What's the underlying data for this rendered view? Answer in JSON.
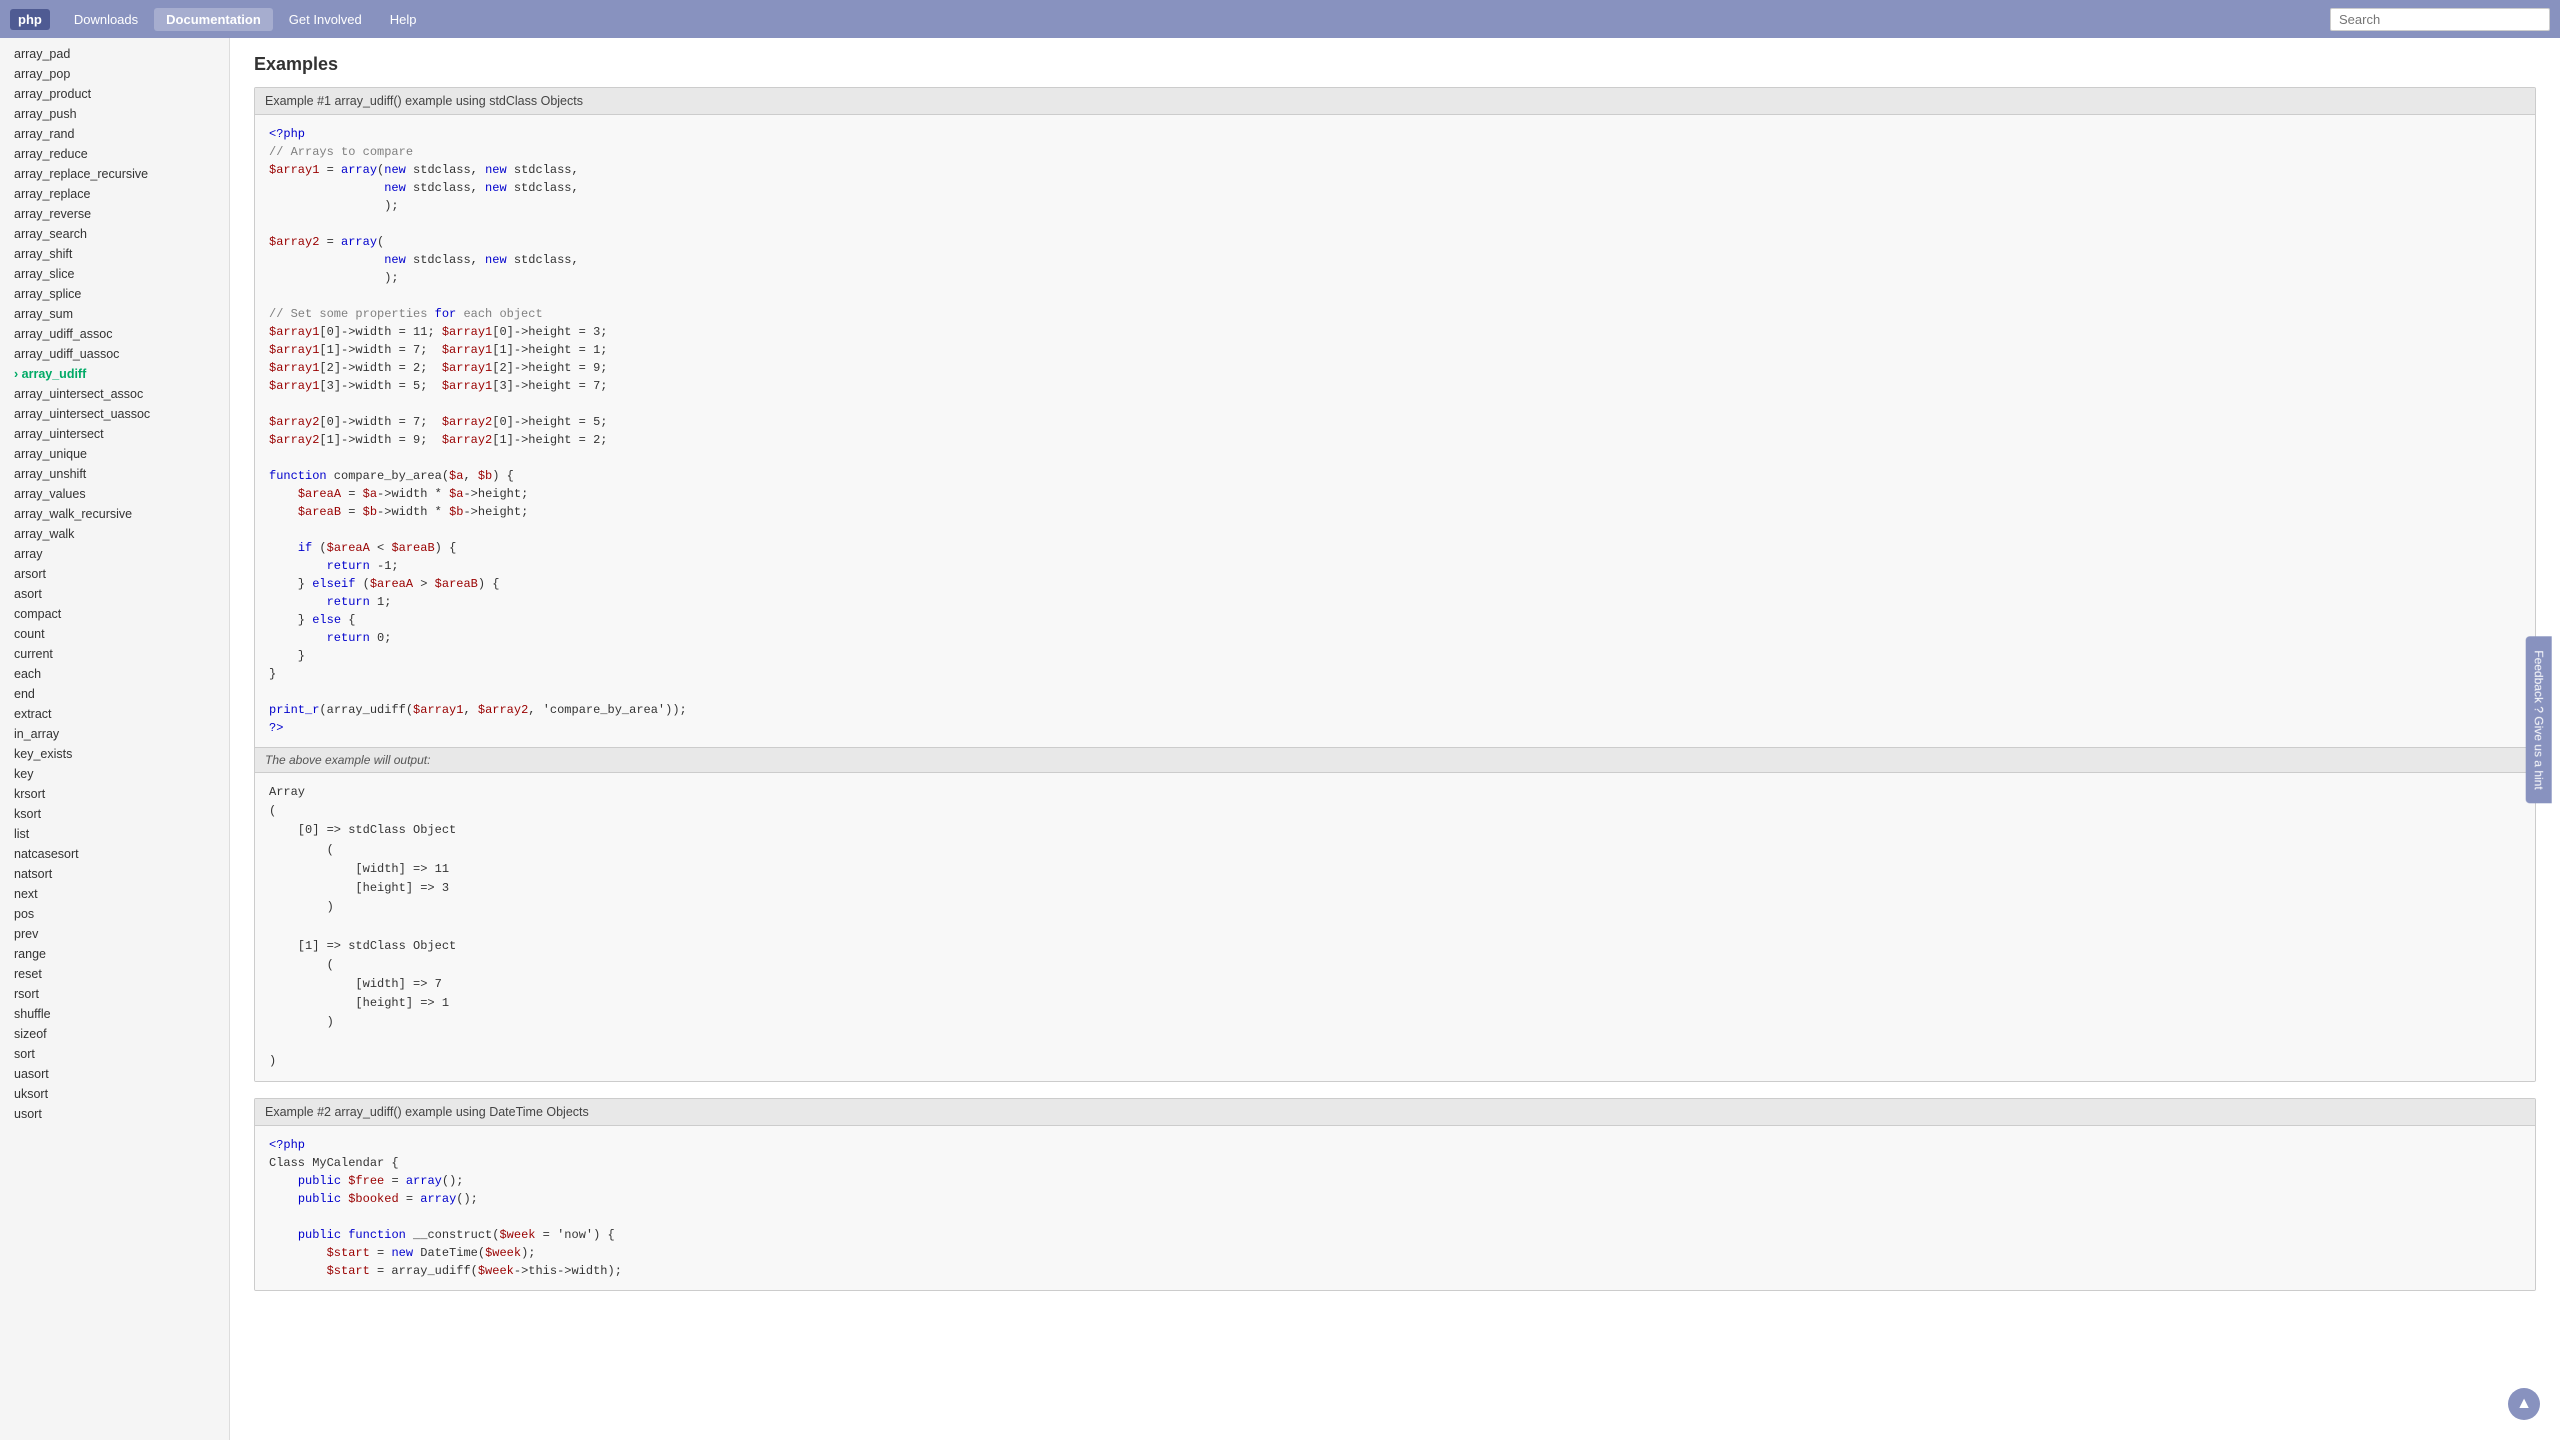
{
  "nav": {
    "logo": "php",
    "items": [
      {
        "label": "Downloads",
        "active": false
      },
      {
        "label": "Documentation",
        "active": true
      },
      {
        "label": "Get Involved",
        "active": false
      },
      {
        "label": "Help",
        "active": false
      }
    ],
    "search_placeholder": "Search"
  },
  "sidebar": {
    "items": [
      {
        "label": "array_pad",
        "active": false
      },
      {
        "label": "array_pop",
        "active": false
      },
      {
        "label": "array_product",
        "active": false
      },
      {
        "label": "array_push",
        "active": false
      },
      {
        "label": "array_rand",
        "active": false
      },
      {
        "label": "array_reduce",
        "active": false
      },
      {
        "label": "array_replace_recursive",
        "active": false
      },
      {
        "label": "array_replace",
        "active": false
      },
      {
        "label": "array_reverse",
        "active": false
      },
      {
        "label": "array_search",
        "active": false
      },
      {
        "label": "array_shift",
        "active": false
      },
      {
        "label": "array_slice",
        "active": false
      },
      {
        "label": "array_splice",
        "active": false
      },
      {
        "label": "array_sum",
        "active": false
      },
      {
        "label": "array_udiff_assoc",
        "active": false
      },
      {
        "label": "array_udiff_uassoc",
        "active": false
      },
      {
        "label": "array_udiff",
        "active": true
      },
      {
        "label": "array_uintersect_assoc",
        "active": false
      },
      {
        "label": "array_uintersect_uassoc",
        "active": false
      },
      {
        "label": "array_uintersect",
        "active": false
      },
      {
        "label": "array_unique",
        "active": false
      },
      {
        "label": "array_unshift",
        "active": false
      },
      {
        "label": "array_values",
        "active": false
      },
      {
        "label": "array_walk_recursive",
        "active": false
      },
      {
        "label": "array_walk",
        "active": false
      },
      {
        "label": "array",
        "active": false
      },
      {
        "label": "arsort",
        "active": false
      },
      {
        "label": "asort",
        "active": false
      },
      {
        "label": "compact",
        "active": false
      },
      {
        "label": "count",
        "active": false
      },
      {
        "label": "current",
        "active": false
      },
      {
        "label": "each",
        "active": false
      },
      {
        "label": "end",
        "active": false
      },
      {
        "label": "extract",
        "active": false
      },
      {
        "label": "in_array",
        "active": false
      },
      {
        "label": "key_exists",
        "active": false
      },
      {
        "label": "key",
        "active": false
      },
      {
        "label": "krsort",
        "active": false
      },
      {
        "label": "ksort",
        "active": false
      },
      {
        "label": "list",
        "active": false
      },
      {
        "label": "natcasesort",
        "active": false
      },
      {
        "label": "natsort",
        "active": false
      },
      {
        "label": "next",
        "active": false
      },
      {
        "label": "pos",
        "active": false
      },
      {
        "label": "prev",
        "active": false
      },
      {
        "label": "range",
        "active": false
      },
      {
        "label": "reset",
        "active": false
      },
      {
        "label": "rsort",
        "active": false
      },
      {
        "label": "shuffle",
        "active": false
      },
      {
        "label": "sizeof",
        "active": false
      },
      {
        "label": "sort",
        "active": false
      },
      {
        "label": "uasort",
        "active": false
      },
      {
        "label": "uksort",
        "active": false
      },
      {
        "label": "usort",
        "active": false
      }
    ]
  },
  "main": {
    "section_title": "Examples",
    "example1": {
      "title": "Example #1 array_udiff() example using stdClass Objects",
      "code": "<?php\n// Arrays to compare\n$array1 = array(new stdclass, new stdclass,\n                new stdclass, new stdclass,\n                );\n\n$array2 = array(\n                new stdclass, new stdclass,\n                );\n\n// Set some properties for each object\n$array1[0]->width = 11; $array1[0]->height = 3;\n$array1[1]->width = 7;  $array1[1]->height = 1;\n$array1[2]->width = 2;  $array1[2]->height = 9;\n$array1[3]->width = 5;  $array1[3]->height = 7;\n\n$array2[0]->width = 7;  $array2[0]->height = 5;\n$array2[1]->width = 9;  $array2[1]->height = 2;\n\nfunction compare_by_area($a, $b) {\n    $areaA = $a->width * $a->height;\n    $areaB = $b->width * $b->height;\n\n    if ($areaA < $areaB) {\n        return -1;\n    } elseif ($areaA > $areaB) {\n        return 1;\n    } else {\n        return 0;\n    }\n}\n\nprint_r(array_udiff($array1, $array2, 'compare_by_area'));\n?>",
      "output_label": "The above example will output:",
      "output": "Array\n(\n    [0] => stdClass Object\n        (\n            [width] => 11\n            [height] => 3\n        )\n\n    [1] => stdClass Object\n        (\n            [width] => 7\n            [height] => 1\n        )\n\n)"
    },
    "example2": {
      "title": "Example #2 array_udiff() example using DateTime Objects",
      "code": "<?php\nClass MyCalendar {\n    public $free = array();\n    public $booked = array();\n\n    public function __construct($week = 'now') {\n        $start = new DateTime($week);\n        $start = array_udiff($week->this->width);"
    }
  },
  "feedback": {
    "label": "Feedback ? Give us a hint"
  },
  "scroll_top": "▲"
}
